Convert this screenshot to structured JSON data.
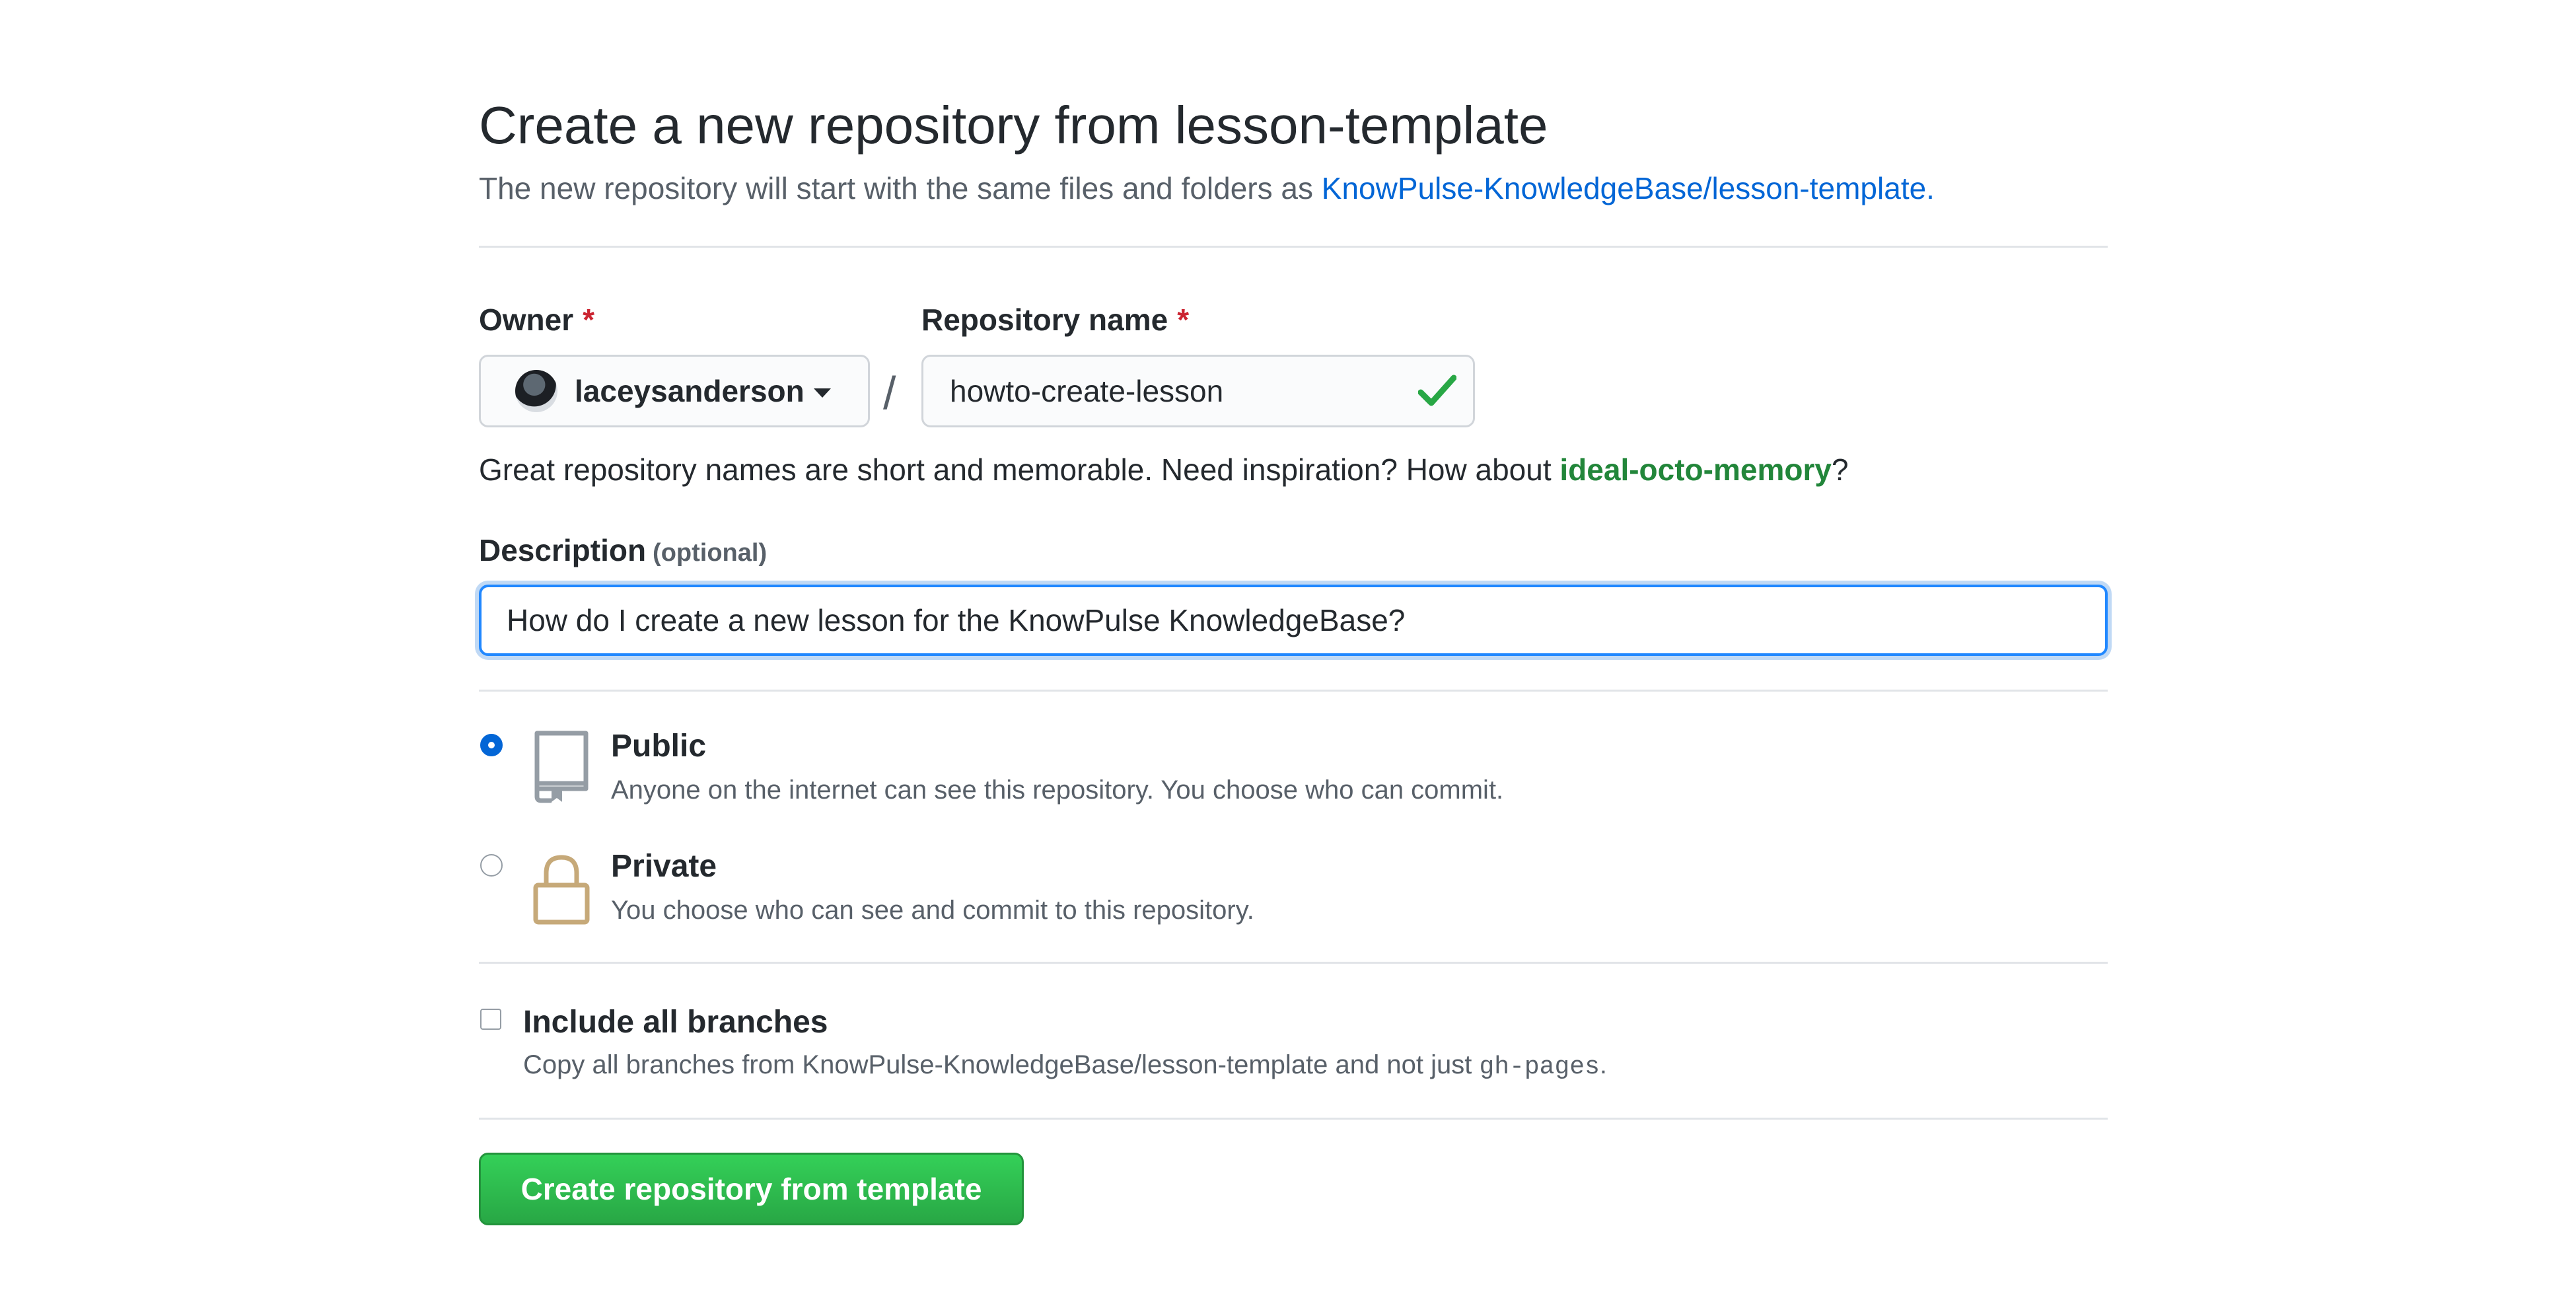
{
  "header": {
    "title": "Create a new repository from lesson-template",
    "subtitle_prefix": "The new repository will start with the same files and folders as ",
    "template_link": "KnowPulse-KnowledgeBase/lesson-template.",
    "subtitle_suffix": ""
  },
  "owner": {
    "label": "Owner",
    "required_mark": "*",
    "value": "laceysanderson"
  },
  "separator": "/",
  "repo_name": {
    "label": "Repository name",
    "required_mark": "*",
    "value": "howto-create-lesson"
  },
  "hint": {
    "prefix": "Great repository names are short and memorable. Need inspiration? How about ",
    "suggestion": "ideal-octo-memory",
    "suffix": "?"
  },
  "description": {
    "label": "Description",
    "optional_tag": "(optional)",
    "value": "How do I create a new lesson for the KnowPulse KnowledgeBase?"
  },
  "visibility": {
    "public": {
      "title": "Public",
      "desc": "Anyone on the internet can see this repository. You choose who can commit.",
      "selected": true
    },
    "private": {
      "title": "Private",
      "desc": "You choose who can see and commit to this repository.",
      "selected": false
    }
  },
  "branches": {
    "title": "Include all branches",
    "desc_prefix": "Copy all branches from KnowPulse-KnowledgeBase/lesson-template and not just ",
    "desc_code": "gh-pages",
    "desc_suffix": ".",
    "checked": false
  },
  "submit": {
    "label": "Create repository from template"
  },
  "colors": {
    "link": "#0366d6",
    "required": "#cb2431",
    "suggestion": "#22863a",
    "button": "#2ea44f",
    "focus": "#2188ff"
  },
  "icons": {
    "owner_dropdown": "caret-down-icon",
    "name_valid": "check-icon",
    "public": "repo-book-icon",
    "private": "lock-icon"
  }
}
